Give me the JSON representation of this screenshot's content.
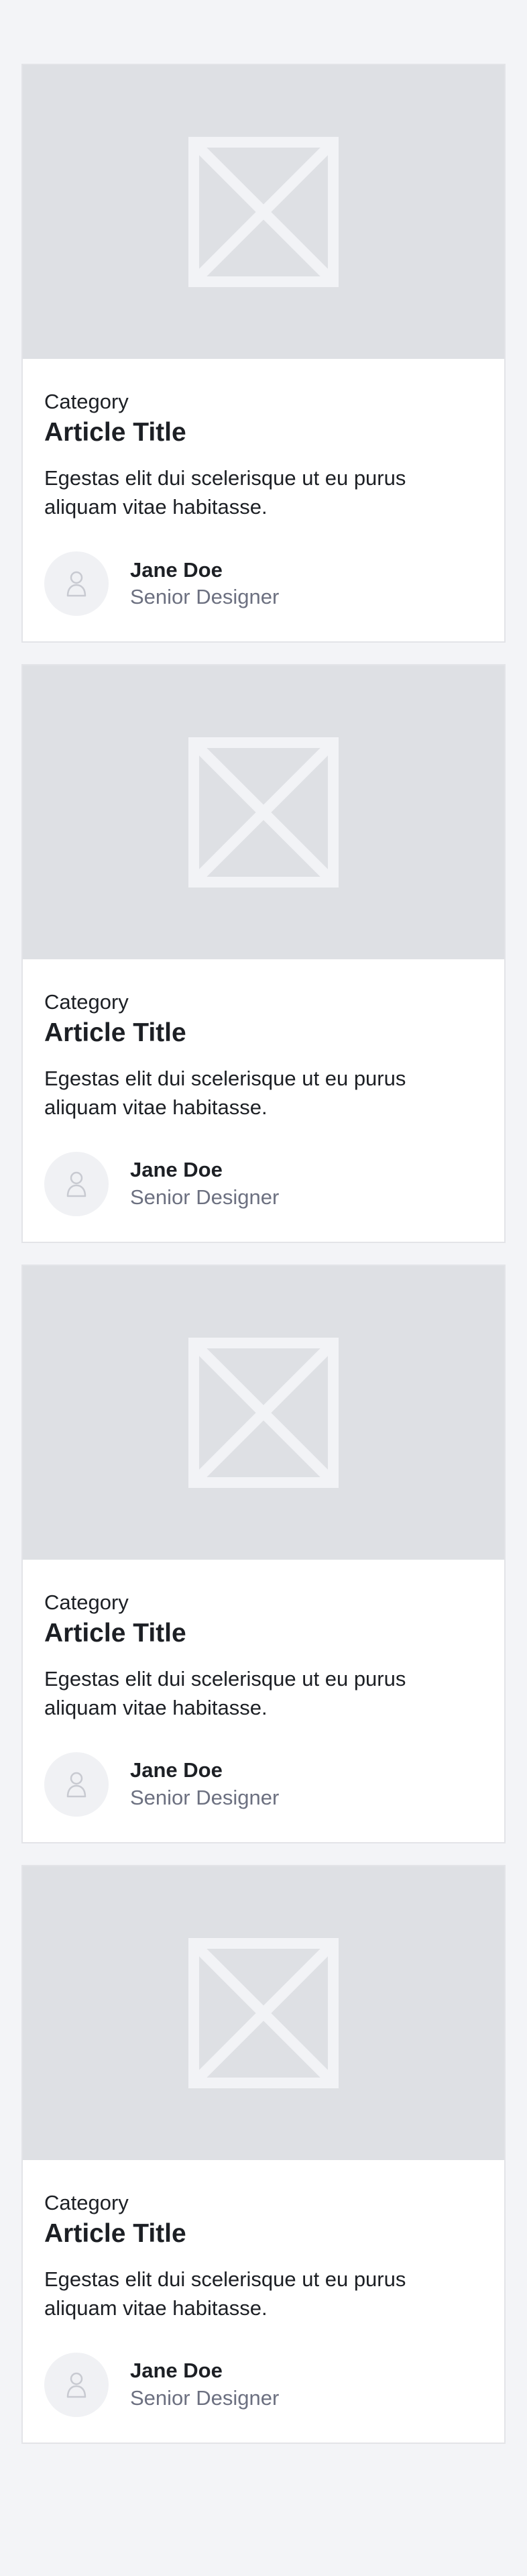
{
  "colors": {
    "page_background": "#f3f4f7",
    "card_background": "#ffffff",
    "image_placeholder": "#dee0e4",
    "placeholder_icon": "#f2f3f6",
    "text_primary": "#1c1f24",
    "text_secondary": "#6c7080"
  },
  "cards": [
    {
      "image_icon": "image-placeholder-icon",
      "category": "Category",
      "title": "Article Title",
      "excerpt": "Egestas elit dui scelerisque ut eu purus aliquam vitae habitasse.",
      "author": {
        "avatar_icon": "user-icon",
        "name": "Jane Doe",
        "role": "Senior Designer"
      }
    },
    {
      "image_icon": "image-placeholder-icon",
      "category": "Category",
      "title": "Article Title",
      "excerpt": "Egestas elit dui scelerisque ut eu purus aliquam vitae habitasse.",
      "author": {
        "avatar_icon": "user-icon",
        "name": "Jane Doe",
        "role": "Senior Designer"
      }
    },
    {
      "image_icon": "image-placeholder-icon",
      "category": "Category",
      "title": "Article Title",
      "excerpt": "Egestas elit dui scelerisque ut eu purus aliquam vitae habitasse.",
      "author": {
        "avatar_icon": "user-icon",
        "name": "Jane Doe",
        "role": "Senior Designer"
      }
    },
    {
      "image_icon": "image-placeholder-icon",
      "category": "Category",
      "title": "Article Title",
      "excerpt": "Egestas elit dui scelerisque ut eu purus aliquam vitae habitasse.",
      "author": {
        "avatar_icon": "user-icon",
        "name": "Jane Doe",
        "role": "Senior Designer"
      }
    }
  ]
}
